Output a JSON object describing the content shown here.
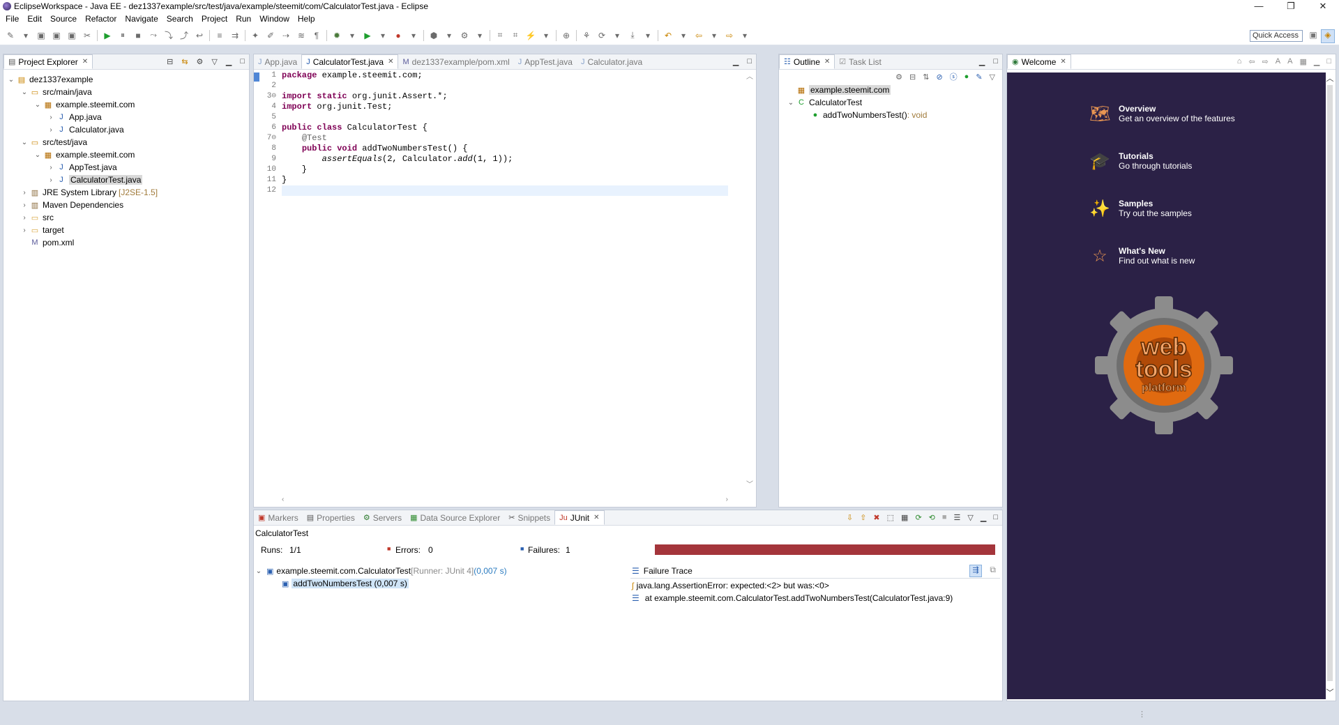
{
  "window": {
    "title": "EclipseWorkspace - Java EE - dez1337example/src/test/java/example/steemit/com/CalculatorTest.java - Eclipse",
    "controls": [
      "—",
      "❐",
      "✕"
    ]
  },
  "menu": [
    "File",
    "Edit",
    "Source",
    "Refactor",
    "Navigate",
    "Search",
    "Project",
    "Run",
    "Window",
    "Help"
  ],
  "toolbar": {
    "quick_access": "Quick Access"
  },
  "project_explorer": {
    "tab_label": "Project Explorer",
    "tree": [
      {
        "label": "dez1337example",
        "indent": 0,
        "twisty": "⌄",
        "icon": "project"
      },
      {
        "label": "src/main/java",
        "indent": 1,
        "twisty": "⌄",
        "icon": "srcfolder"
      },
      {
        "label": "example.steemit.com",
        "indent": 2,
        "twisty": "⌄",
        "icon": "package"
      },
      {
        "label": "App.java",
        "indent": 3,
        "twisty": "›",
        "icon": "java"
      },
      {
        "label": "Calculator.java",
        "indent": 3,
        "twisty": "›",
        "icon": "java"
      },
      {
        "label": "src/test/java",
        "indent": 1,
        "twisty": "⌄",
        "icon": "srcfolder"
      },
      {
        "label": "example.steemit.com",
        "indent": 2,
        "twisty": "⌄",
        "icon": "package"
      },
      {
        "label": "AppTest.java",
        "indent": 3,
        "twisty": "›",
        "icon": "java"
      },
      {
        "label": "CalculatorTest.java",
        "indent": 3,
        "twisty": "›",
        "icon": "java",
        "selected": true
      },
      {
        "label": "JRE System Library",
        "deco": "[J2SE-1.5]",
        "indent": 1,
        "twisty": "›",
        "icon": "library"
      },
      {
        "label": "Maven Dependencies",
        "indent": 1,
        "twisty": "›",
        "icon": "library"
      },
      {
        "label": "src",
        "indent": 1,
        "twisty": "›",
        "icon": "folder"
      },
      {
        "label": "target",
        "indent": 1,
        "twisty": "›",
        "icon": "folder"
      },
      {
        "label": "pom.xml",
        "indent": 1,
        "twisty": "",
        "icon": "xml"
      }
    ]
  },
  "editor": {
    "tabs": [
      {
        "label": "App.java",
        "active": false
      },
      {
        "label": "CalculatorTest.java",
        "active": true
      },
      {
        "label": "dez1337example/pom.xml",
        "active": false
      },
      {
        "label": "AppTest.java",
        "active": false
      },
      {
        "label": "Calculator.java",
        "active": false
      }
    ],
    "line_numbers": [
      "1",
      "2",
      "3",
      "4",
      "5",
      "6",
      "7",
      "8",
      "9",
      "10",
      "11",
      "12"
    ],
    "fold_markers": {
      "3": "⊖",
      "7": "⊖"
    },
    "lines": [
      [
        {
          "t": "package",
          "c": "kw"
        },
        {
          "t": " example.steemit.com;"
        }
      ],
      [],
      [
        {
          "t": "import",
          "c": "kw"
        },
        {
          "t": " "
        },
        {
          "t": "static",
          "c": "kw"
        },
        {
          "t": " org.junit.Assert.*;"
        }
      ],
      [
        {
          "t": "import",
          "c": "kw"
        },
        {
          "t": " org.junit.Test;"
        }
      ],
      [],
      [
        {
          "t": "public",
          "c": "kw"
        },
        {
          "t": " "
        },
        {
          "t": "class",
          "c": "kw"
        },
        {
          "t": " CalculatorTest {"
        }
      ],
      [
        {
          "t": "    "
        },
        {
          "t": "@Test",
          "c": "ann"
        }
      ],
      [
        {
          "t": "    "
        },
        {
          "t": "public",
          "c": "kw"
        },
        {
          "t": " "
        },
        {
          "t": "void",
          "c": "kw"
        },
        {
          "t": " addTwoNumbersTest() {"
        }
      ],
      [
        {
          "t": "        "
        },
        {
          "t": "assertEquals",
          "c": "it"
        },
        {
          "t": "(2, Calculator."
        },
        {
          "t": "add",
          "c": "it"
        },
        {
          "t": "(1, 1));"
        }
      ],
      [
        {
          "t": "    }"
        }
      ],
      [
        {
          "t": "}"
        }
      ],
      []
    ]
  },
  "outline": {
    "tabs": [
      {
        "label": "Outline",
        "active": true
      },
      {
        "label": "Task List",
        "active": false
      }
    ],
    "items": [
      {
        "label": "example.steemit.com",
        "indent": 0,
        "twisty": "",
        "icon": "package",
        "selected": true
      },
      {
        "label": "CalculatorTest",
        "indent": 0,
        "twisty": "⌄",
        "icon": "class"
      },
      {
        "label": "addTwoNumbersTest()",
        "suffix": " : void",
        "indent": 1,
        "twisty": "",
        "icon": "method"
      }
    ]
  },
  "welcome": {
    "tab_label": "Welcome",
    "items": [
      {
        "title": "Overview",
        "desc": "Get an overview of the features",
        "icon": "map-icon",
        "glyph": "🗺"
      },
      {
        "title": "Tutorials",
        "desc": "Go through tutorials",
        "icon": "graduation-cap-icon",
        "glyph": "🎓"
      },
      {
        "title": "Samples",
        "desc": "Try out the samples",
        "icon": "magic-wand-icon",
        "glyph": "✨"
      },
      {
        "title": "What's New",
        "desc": "Find out what is new",
        "icon": "star-icon",
        "glyph": "☆"
      }
    ],
    "logo": {
      "line1": "web",
      "line2": "tools",
      "line3": "platform"
    }
  },
  "bottom": {
    "tabs": [
      {
        "label": "Markers",
        "active": false
      },
      {
        "label": "Properties",
        "active": false
      },
      {
        "label": "Servers",
        "active": false
      },
      {
        "label": "Data Source Explorer",
        "active": false
      },
      {
        "label": "Snippets",
        "active": false
      },
      {
        "label": "JUnit",
        "active": true
      }
    ],
    "junit": {
      "test_name": "CalculatorTest",
      "runs_label": "Runs:",
      "runs_value": "1/1",
      "errors_label": "Errors:",
      "errors_value": "0",
      "failures_label": "Failures:",
      "failures_value": "1",
      "bar_color": "#a4353b",
      "suite": "example.steemit.com.CalculatorTest",
      "suite_runner": " [Runner: JUnit 4]",
      "suite_time": " (0,007 s)",
      "test": "addTwoNumbersTest (0,007 s)",
      "failure_trace_label": "Failure Trace",
      "trace": [
        "java.lang.AssertionError: expected:<2> but was:<0>",
        "at example.steemit.com.CalculatorTest.addTwoNumbersTest(CalculatorTest.java:9)"
      ]
    }
  }
}
